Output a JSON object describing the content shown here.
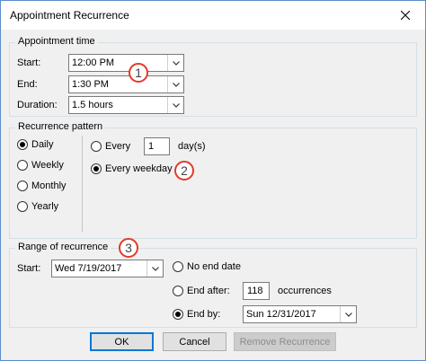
{
  "window": {
    "title": "Appointment Recurrence"
  },
  "appointment_time": {
    "legend": "Appointment time",
    "start_label": "Start:",
    "start_value": "12:00 PM",
    "end_label": "End:",
    "end_value": "1:30 PM",
    "duration_label": "Duration:",
    "duration_value": "1.5 hours"
  },
  "recurrence_pattern": {
    "legend": "Recurrence pattern",
    "options": [
      "Daily",
      "Weekly",
      "Monthly",
      "Yearly"
    ],
    "selected": "Daily",
    "every_label": "Every",
    "every_value": "1",
    "days_label": "day(s)",
    "every_weekday_label": "Every weekday"
  },
  "range": {
    "legend": "Range of recurrence",
    "start_label": "Start:",
    "start_value": "Wed 7/19/2017",
    "no_end_label": "No end date",
    "end_after_label": "End after:",
    "occurrences_value": "118",
    "occurrences_label": "occurrences",
    "end_by_label": "End by:",
    "end_by_value": "Sun 12/31/2017"
  },
  "annotations": [
    "1",
    "2",
    "3"
  ],
  "buttons": {
    "ok": "OK",
    "cancel": "Cancel",
    "remove": "Remove Recurrence"
  },
  "colors": {
    "badge_border": "#e23b2a",
    "window_border": "#5b8dc8",
    "default_button_border": "#0078d7"
  }
}
